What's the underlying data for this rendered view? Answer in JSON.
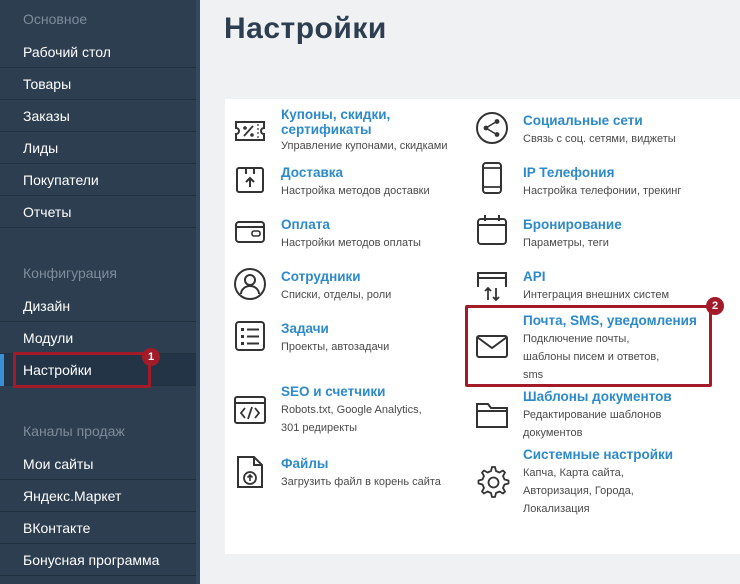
{
  "sidebar": {
    "sections": [
      {
        "label": "Основное"
      },
      {
        "label": "Конфигурация"
      },
      {
        "label": "Каналы продаж"
      }
    ],
    "items": [
      {
        "label": "Рабочий стол"
      },
      {
        "label": "Товары"
      },
      {
        "label": "Заказы"
      },
      {
        "label": "Лиды"
      },
      {
        "label": "Покупатели"
      },
      {
        "label": "Отчеты"
      },
      {
        "label": "Дизайн"
      },
      {
        "label": "Модули"
      },
      {
        "label": "Настройки"
      },
      {
        "label": "Мои сайты"
      },
      {
        "label": "Яндекс.Маркет"
      },
      {
        "label": "ВКонтакте"
      },
      {
        "label": "Бонусная программа"
      }
    ]
  },
  "header": {
    "title": "Настройки"
  },
  "tiles": {
    "coupons": {
      "title1": "Купоны, скидки,",
      "title2": "сертификаты",
      "desc": "Управление купонами, скидками"
    },
    "delivery": {
      "title": "Доставка",
      "desc": "Настройка методов доставки"
    },
    "payment": {
      "title": "Оплата",
      "desc": "Настройки методов оплаты"
    },
    "staff": {
      "title": "Сотрудники",
      "desc": "Списки, отделы, роли"
    },
    "tasks": {
      "title": "Задачи",
      "desc": "Проекты, автозадачи"
    },
    "seo": {
      "title": "SEO и счетчики",
      "desc1": "Robots.txt, Google Analytics,",
      "desc2": "301 редиректы"
    },
    "files": {
      "title": "Файлы",
      "desc": "Загрузить файл в корень сайта"
    },
    "social": {
      "title": "Социальные сети",
      "desc": "Связь с соц. сетями, виджеты"
    },
    "telephony": {
      "title": "IP Телефония",
      "desc": "Настройка телефонии, трекинг"
    },
    "booking": {
      "title": "Бронирование",
      "desc": "Параметры, теги"
    },
    "api": {
      "title": "API",
      "desc": "Интеграция внешних систем"
    },
    "mail": {
      "title": "Почта, SMS, уведомления",
      "desc1": "Подключение почты,",
      "desc2": "шаблоны писем и ответов,",
      "desc3": "sms"
    },
    "doctemplates": {
      "title": "Шаблоны документов",
      "desc1": "Редактирование шаблонов",
      "desc2": "документов"
    },
    "system": {
      "title": "Системные настройки",
      "desc1": "Капча, Карта сайта,",
      "desc2": "Авторизация, Города,",
      "desc3": "Локализация"
    }
  },
  "callouts": {
    "badge1": "1",
    "badge2": "2"
  },
  "colors": {
    "sidebar_bg": "#2c3e50",
    "accent_link": "#2d8ac9",
    "highlight": "#a31b28",
    "active_bar": "#3a8fd6"
  }
}
